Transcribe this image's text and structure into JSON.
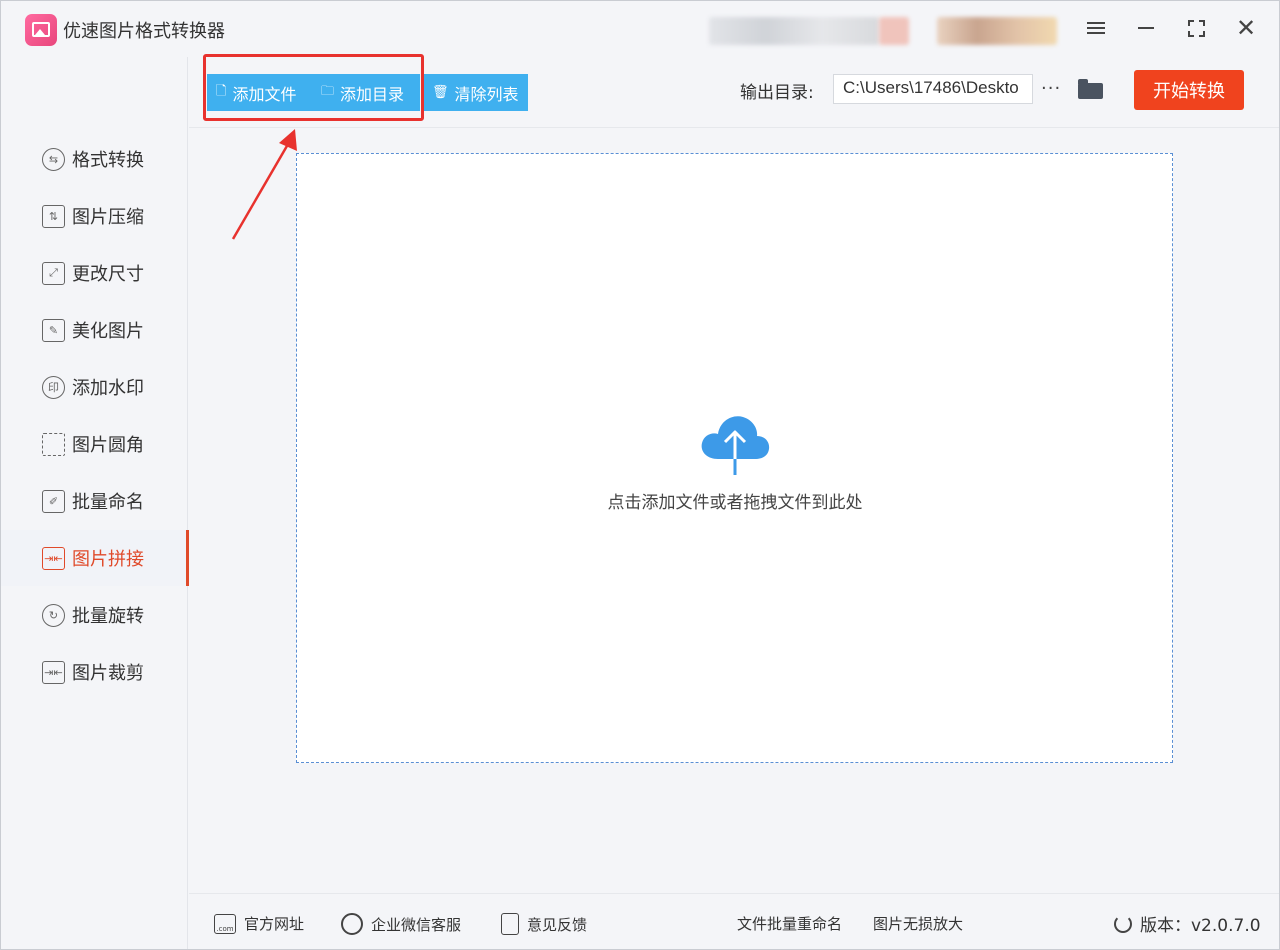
{
  "app": {
    "title": "优速图片格式转换器"
  },
  "sidebar": {
    "items": [
      {
        "label": "格式转换",
        "icon": "convert-icon"
      },
      {
        "label": "图片压缩",
        "icon": "compress-icon"
      },
      {
        "label": "更改尺寸",
        "icon": "resize-icon"
      },
      {
        "label": "美化图片",
        "icon": "beautify-icon"
      },
      {
        "label": "添加水印",
        "icon": "watermark-icon"
      },
      {
        "label": "图片圆角",
        "icon": "round-corner-icon"
      },
      {
        "label": "批量命名",
        "icon": "rename-icon"
      },
      {
        "label": "图片拼接",
        "icon": "merge-icon",
        "active": true
      },
      {
        "label": "批量旋转",
        "icon": "rotate-icon"
      },
      {
        "label": "图片裁剪",
        "icon": "crop-icon"
      }
    ]
  },
  "toolbar": {
    "add_file": "添加文件",
    "add_folder": "添加目录",
    "clear_list": "清除列表",
    "output_label": "输出目录:",
    "output_path": "C:\\Users\\17486\\Deskto",
    "more": "···",
    "start": "开始转换"
  },
  "dropzone": {
    "hint": "点击添加文件或者拖拽文件到此处"
  },
  "footer": {
    "website": "官方网址",
    "wechat": "企业微信客服",
    "feedback": "意见反馈",
    "batch_rename": "文件批量重命名",
    "lossless": "图片无损放大",
    "version": "版本：v2.0.7.0"
  },
  "colors": {
    "accent_blue": "#3fb0ef",
    "start_orange": "#f0431e",
    "active_red": "#e04a2a",
    "annotation_red": "#e8322e"
  }
}
